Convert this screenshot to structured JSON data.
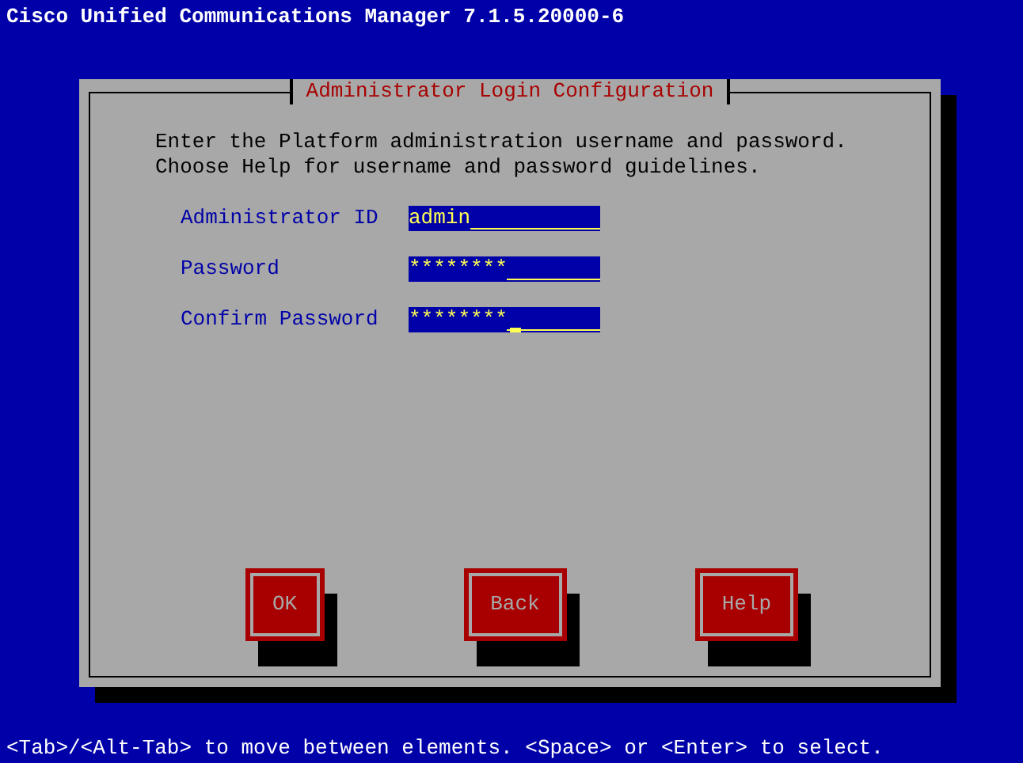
{
  "screen_title": "Cisco Unified Communications Manager 7.1.5.20000-6",
  "dialog": {
    "title": "Administrator Login Configuration",
    "instructions": [
      "Enter the Platform administration username and password.",
      "Choose Help for username and password guidelines."
    ],
    "fields": [
      {
        "label": "Administrator ID",
        "value": "admin",
        "focused": false
      },
      {
        "label": "Password",
        "value": "********",
        "focused": false
      },
      {
        "label": "Confirm Password",
        "value": "********",
        "focused": true
      }
    ],
    "buttons": [
      "OK",
      "Back",
      "Help"
    ]
  },
  "status_bar": "<Tab>/<Alt-Tab> to move between elements. <Space> or <Enter> to select."
}
